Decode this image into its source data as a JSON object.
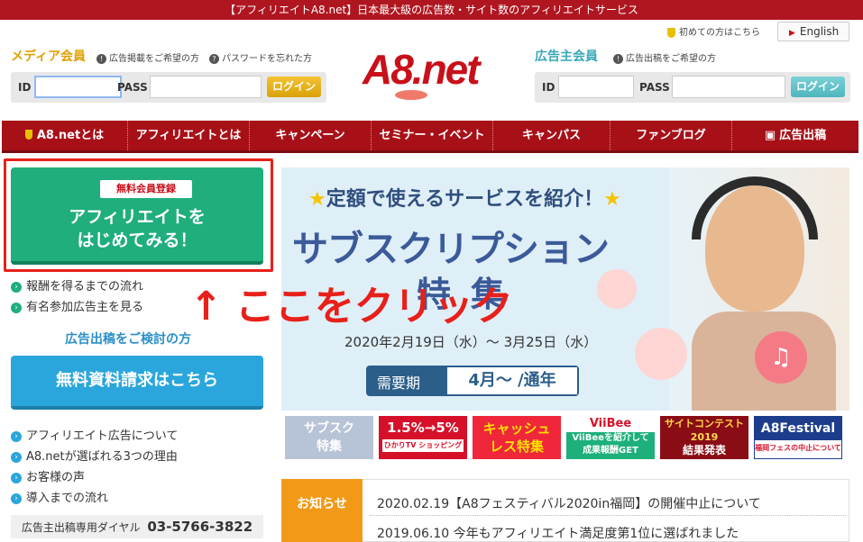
{
  "topbar": {
    "text": "【アフィリエイトA8.net】日本最大級の広告数・サイト数のアフィリエイトサービス"
  },
  "header": {
    "first_time": "初めての方はこちら",
    "english": "English",
    "logo": "A8.net",
    "media": {
      "label": "メディア会員",
      "link1": "広告掲載をご希望の方",
      "link2": "パスワードを忘れた方",
      "id_label": "ID",
      "pass_label": "PASS",
      "login": "ログイン"
    },
    "advertiser": {
      "label": "広告主会員",
      "link1": "広告出稿をご希望の方",
      "id_label": "ID",
      "pass_label": "PASS",
      "login": "ログイン"
    }
  },
  "nav": [
    "A8.netとは",
    "アフィリエイトとは",
    "キャンペーン",
    "セミナー・イベント",
    "キャンパス",
    "ファンブログ",
    "広告出稿"
  ],
  "sidebar": {
    "signup_badge": "無料会員登録",
    "signup_line1": "アフィリエイトを",
    "signup_line2": "はじめてみる！",
    "links1": [
      "報酬を得るまでの流れ",
      "有名参加広告主を見る"
    ],
    "ad_consider": "広告出稿をご検討の方",
    "request_btn": "無料資料請求はこちら",
    "links2": [
      "アフィリエイト広告について",
      "A8.netが選ばれる3つの理由",
      "お客様の声",
      "導入までの流れ"
    ],
    "dial_label": "広告主出稿専用ダイヤル",
    "dial_number": "03-5766-3822"
  },
  "annotation": {
    "arrow": "↑",
    "text": "ここをクリック"
  },
  "banner": {
    "headline": "定額で使えるサービスを紹介！",
    "title": "サブスクリプション",
    "subtitle": "特集",
    "dates": "2020年2月19日（水）～ 3月25日（水）",
    "demand_label": "需要期",
    "demand_value": "4月～ /通年"
  },
  "thumbs": {
    "t1_line1": "サブスク",
    "t1_line2": "特集",
    "t2_line1": "1.5%→5%",
    "t2_line2": "ひかりTV ショッピング",
    "t3_line1": "キャッシュ",
    "t3_line2": "レス特集",
    "t4_line1": "ViiBee",
    "t4_line2": "ViiBeeを紹介して",
    "t4_line3": "成果報酬GET",
    "t5_line1": "サイトコンテスト",
    "t5_line2": "2019",
    "t5_line3": "結果発表",
    "t6_line1": "A8Festival",
    "t6_line2": "福岡フェスの中止について"
  },
  "news": {
    "heading": "お知らせ",
    "items": [
      "2020.02.19【A8フェスティバル2020in福岡】の開催中止について",
      "2019.06.10 今年もアフィリエイト満足度第1位に選ばれました"
    ]
  }
}
